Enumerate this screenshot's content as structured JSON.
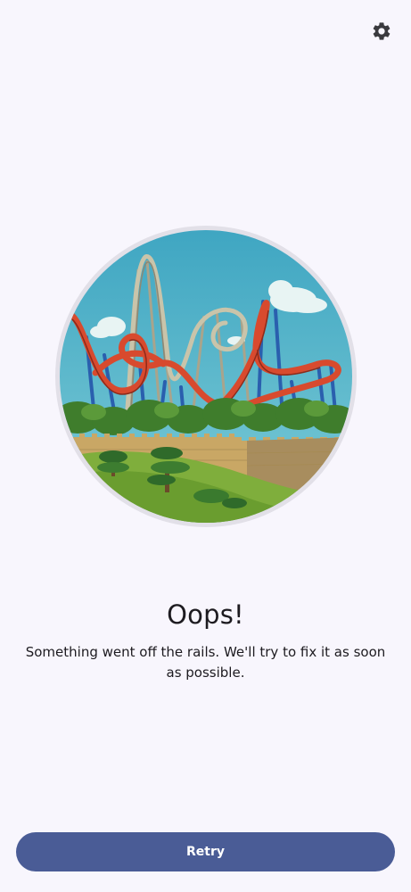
{
  "header": {
    "settings_icon": "gear-icon"
  },
  "illustration": {
    "icon": "roller-coaster-illustration",
    "colors": {
      "sky": "#4cb0c8",
      "track_red": "#d84a2e",
      "track_blue": "#2a5fae",
      "wall": "#c9a765",
      "grass": "#7fae3c"
    }
  },
  "error": {
    "title": "Oops!",
    "message": "Something went off the rails. We'll try to fix it as soon as possible."
  },
  "actions": {
    "retry_label": "Retry"
  },
  "colors": {
    "background": "#f8f6fd",
    "primary": "#4a5c96",
    "text": "#1d1b20"
  }
}
